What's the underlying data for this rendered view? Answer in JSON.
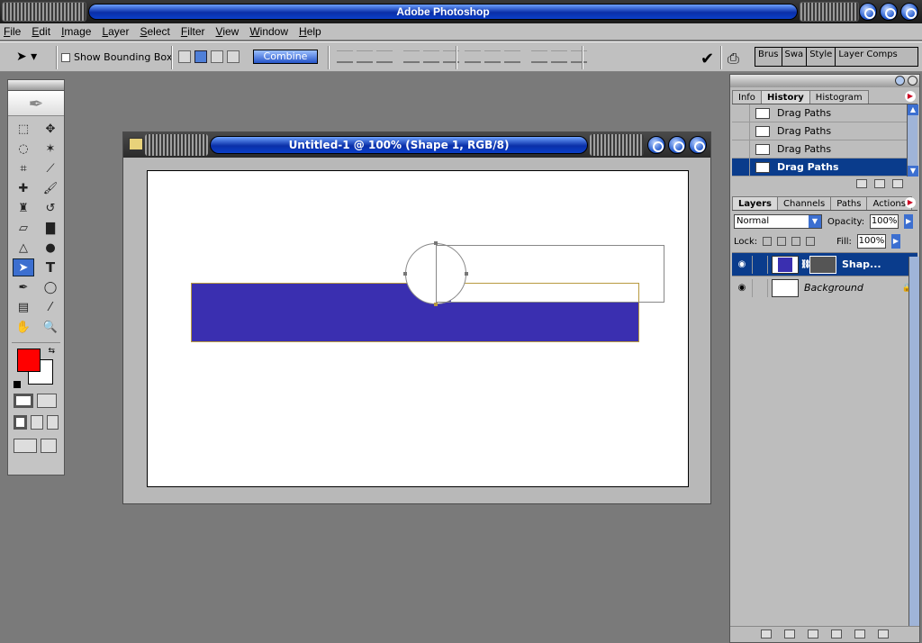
{
  "app": {
    "title": "Adobe Photoshop"
  },
  "menu": [
    "File",
    "Edit",
    "Image",
    "Layer",
    "Select",
    "Filter",
    "View",
    "Window",
    "Help"
  ],
  "options": {
    "show_bounding_box": "Show Bounding Box",
    "combine": "Combine",
    "palette_well": [
      "Brus",
      "Swa",
      "Style",
      "Layer Comps"
    ]
  },
  "toolbox": {
    "foreground_color": "#ff0000",
    "background_color": "#ffffff"
  },
  "document": {
    "title": "Untitled-1 @ 100% (Shape 1, RGB/8)",
    "shape_color": "#3a2fb0"
  },
  "history_panel": {
    "tabs": [
      "Info",
      "History",
      "Histogram"
    ],
    "active_tab": "History",
    "items": [
      "Drag Paths",
      "Drag Paths",
      "Drag Paths",
      "Drag Paths"
    ]
  },
  "layers_panel": {
    "tabs": [
      "Layers",
      "Channels",
      "Paths",
      "Actions"
    ],
    "blend_mode": "Normal",
    "opacity_label": "Opacity:",
    "opacity": "100%",
    "lock_label": "Lock:",
    "fill_label": "Fill:",
    "fill": "100%",
    "layers": [
      {
        "name": "Shap...",
        "active": true
      },
      {
        "name": "Background",
        "active": false
      }
    ]
  }
}
